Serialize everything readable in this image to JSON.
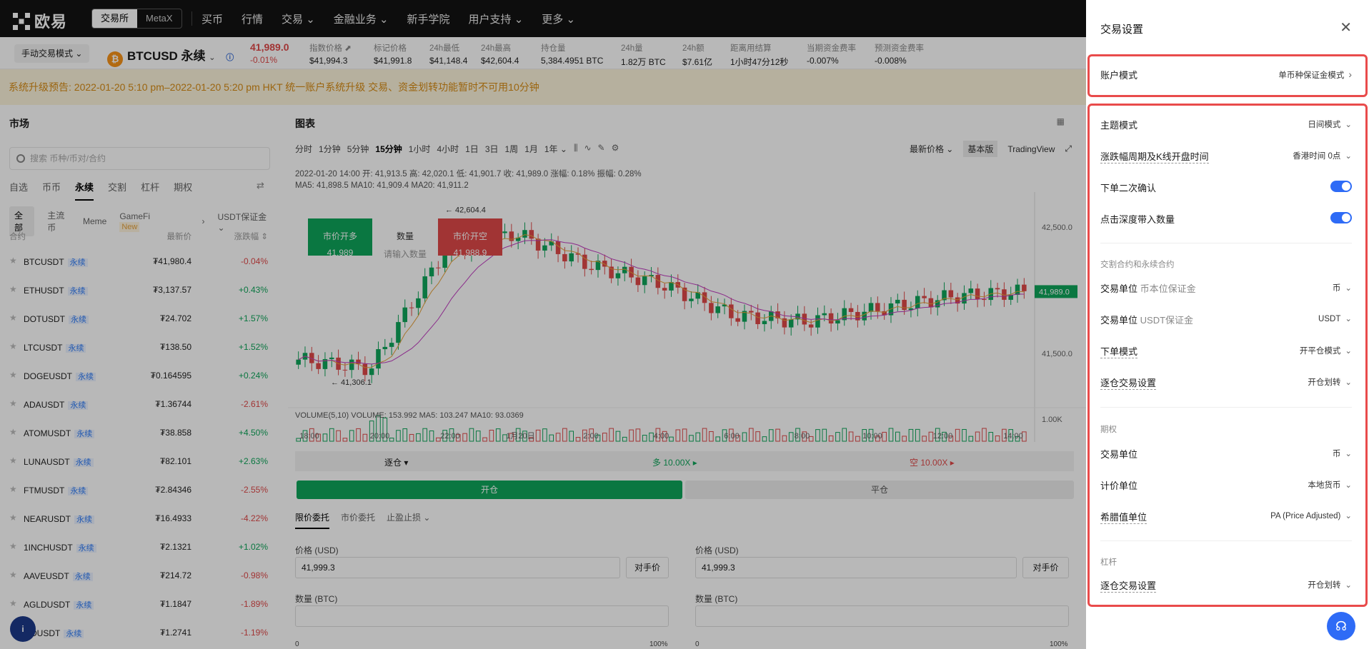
{
  "nav": {
    "logo": "欧易",
    "seg": [
      "交易所",
      "MetaX"
    ],
    "links": [
      "买币",
      "行情",
      "交易 ⌄",
      "金融业务 ⌄",
      "新手学院",
      "用户支持 ⌄",
      "更多 ⌄"
    ]
  },
  "ticker": {
    "mode": "手动交易模式 ⌄",
    "pair": "BTCUSD 永续",
    "last": "41,989.0",
    "change": "-0.01%",
    "stats": [
      {
        "l": "指数价格 ⬈",
        "v": "$41,994.3"
      },
      {
        "l": "标记价格",
        "v": "$41,991.8"
      },
      {
        "l": "24h最低",
        "v": "$41,148.4"
      },
      {
        "l": "24h最高",
        "v": "$42,604.4"
      },
      {
        "l": "持仓量",
        "v": "5,384.4951 BTC"
      },
      {
        "l": "24h量",
        "v": "1.82万 BTC"
      },
      {
        "l": "24h额",
        "v": "$7.61亿"
      },
      {
        "l": "距离用结算",
        "v": "1小时47分12秒"
      },
      {
        "l": "当期资金费率",
        "v": "-0.007%"
      },
      {
        "l": "预测资金费率",
        "v": "-0.008%"
      }
    ]
  },
  "announce": "系统升级预告: 2022-01-20 5:10 pm–2022-01-20 5:20 pm HKT 统一账户系统升级 交易、资金划转功能暂时不可用10分钟",
  "market": {
    "title": "市场",
    "search_placeholder": "搜索 币种/币对/合约",
    "tabs": [
      "自选",
      "币币",
      "永续",
      "交割",
      "杠杆",
      "期权"
    ],
    "chips": [
      "全部",
      "主流币",
      "Meme",
      "GameFi",
      "USDT保证金 ⌄"
    ],
    "new": "New",
    "head": {
      "c1": "合约",
      "c2": "最新价",
      "c3": "涨跌幅 ⇕"
    },
    "tag": "永续",
    "rows": [
      {
        "s": "BTCUSDT",
        "p": "₮41,980.4",
        "c": "-0.04%",
        "d": "dn"
      },
      {
        "s": "ETHUSDT",
        "p": "₮3,137.57",
        "c": "+0.43%",
        "d": "up"
      },
      {
        "s": "DOTUSDT",
        "p": "₮24.702",
        "c": "+1.57%",
        "d": "up"
      },
      {
        "s": "LTCUSDT",
        "p": "₮138.50",
        "c": "+1.52%",
        "d": "up"
      },
      {
        "s": "DOGEUSDT",
        "p": "₮0.164595",
        "c": "+0.24%",
        "d": "up"
      },
      {
        "s": "ADAUSDT",
        "p": "₮1.36744",
        "c": "-2.61%",
        "d": "dn"
      },
      {
        "s": "ATOMUSDT",
        "p": "₮38.858",
        "c": "+4.50%",
        "d": "up"
      },
      {
        "s": "LUNAUSDT",
        "p": "₮82.101",
        "c": "+2.63%",
        "d": "up"
      },
      {
        "s": "FTMUSDT",
        "p": "₮2.84346",
        "c": "-2.55%",
        "d": "dn"
      },
      {
        "s": "NEARUSDT",
        "p": "₮16.4933",
        "c": "-4.22%",
        "d": "dn"
      },
      {
        "s": "1INCHUSDT",
        "p": "₮2.1321",
        "c": "+1.02%",
        "d": "up"
      },
      {
        "s": "AAVEUSDT",
        "p": "₮214.72",
        "c": "-0.98%",
        "d": "dn"
      },
      {
        "s": "AGLDUSDT",
        "p": "₮1.1847",
        "c": "-1.89%",
        "d": "dn"
      },
      {
        "s": "GOUSDT",
        "p": "₮1.2741",
        "c": "-1.19%",
        "d": "dn"
      }
    ]
  },
  "chart": {
    "title": "图表",
    "intervals": [
      "分时",
      "1分钟",
      "5分钟",
      "15分钟",
      "1小时",
      "4小时",
      "1日",
      "3日",
      "1周",
      "1月",
      "1年 ⌄"
    ],
    "right": [
      "最新价格 ⌄",
      "基本版",
      "TradingView"
    ],
    "ohlc": "2022-01-20 14:00  开: 41,913.5  高: 42,020.1  低: 41,901.7  收: 41,989.0  涨幅: 0.18%  振幅: 0.28%",
    "ma": "MA5: 41,898.5   MA10: 41,909.4   MA20: 41,911.2",
    "vol": "VOLUME(5,10)  VOLUME: 153.992  MA5: 103.247  MA10: 93.0369",
    "high_label": "42,604.4",
    "low_label": "41,306.1",
    "price_tag": "41,989.0",
    "y_labels": [
      "42,500.0",
      "41,500.0",
      "1.00K"
    ],
    "x_labels": [
      "18:00",
      "20:00",
      "22:00",
      "1月20日",
      "2:00",
      "4:00",
      "6:00",
      "8:00",
      "10:00",
      "12:00",
      "14:00"
    ],
    "buy": {
      "l": "市价开多",
      "v": "41,989"
    },
    "qty": {
      "l": "数量",
      "v": "请输入数量"
    },
    "sell": {
      "l": "市价开空",
      "v": "41,988.9"
    }
  },
  "orders": {
    "margin": "逐仓 ▾",
    "long": "多 10.00X ▸",
    "short": "空 10.00X ▸",
    "open": "开仓",
    "close": "平仓",
    "tabs": [
      "限价委托",
      "市价委托",
      "止盈止损 ⌄"
    ],
    "price_label": "价格 (USD)",
    "price_value": "41,999.3",
    "counter": "对手价",
    "qty_label": "数量 (BTC)",
    "pct0": "0",
    "pct100": "100%"
  },
  "drawer": {
    "title": "交易设置",
    "account": {
      "k": "账户模式",
      "v": "单币种保证金模式"
    },
    "theme": {
      "k": "主题模式",
      "v": "日间模式"
    },
    "period": {
      "k": "涨跌幅周期及K线开盘时间",
      "v": "香港时间 0点"
    },
    "confirm": {
      "k": "下单二次确认"
    },
    "depth": {
      "k": "点击深度带入数量"
    },
    "g1": "交割合约和永续合约",
    "unit_coin": {
      "k": "交易单位",
      "sub": "币本位保证金",
      "v": "币"
    },
    "unit_usdt": {
      "k": "交易单位",
      "sub": "USDT保证金",
      "v": "USDT"
    },
    "order_mode": {
      "k": "下单模式",
      "v": "开平仓模式"
    },
    "iso1": {
      "k": "逐仓交易设置",
      "v": "开仓划转"
    },
    "g2": "期权",
    "opt_unit": {
      "k": "交易单位",
      "v": "币"
    },
    "quote_unit": {
      "k": "计价单位",
      "v": "本地货币"
    },
    "greek": {
      "k": "希腊值单位",
      "v": "PA (Price Adjusted)"
    },
    "g3": "杠杆",
    "iso2": {
      "k": "逐仓交易设置",
      "v": "开仓划转"
    }
  },
  "chart_data": {
    "type": "candlestick",
    "x": [
      "18:00",
      "20:00",
      "22:00",
      "1月20日",
      "2:00",
      "4:00",
      "6:00",
      "8:00",
      "10:00",
      "12:00",
      "14:00"
    ],
    "close": [
      41450,
      41380,
      42300,
      42450,
      42200,
      42050,
      41800,
      41750,
      41850,
      41950,
      41989
    ],
    "ylim": [
      41250,
      42750
    ],
    "high": 42604.4,
    "low": 41306.1
  }
}
